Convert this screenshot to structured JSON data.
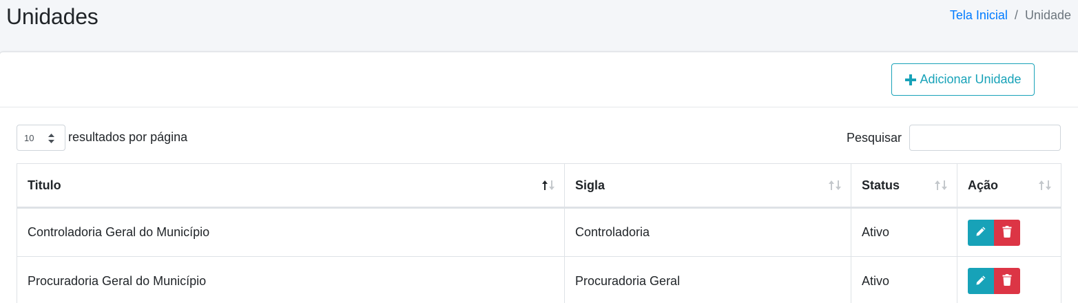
{
  "header": {
    "title": "Unidades",
    "breadcrumb": {
      "home": "Tela Inicial",
      "separator": "/",
      "current": "Unidade"
    }
  },
  "toolbar": {
    "add_label": "Adicionar Unidade",
    "add_icon": "plus-icon"
  },
  "controls": {
    "page_length": "10",
    "page_length_label": "resultados por página",
    "search_label": "Pesquisar",
    "search_value": ""
  },
  "table": {
    "columns": [
      "Titulo",
      "Sigla",
      "Status",
      "Ação"
    ],
    "sorted_column": "Titulo",
    "sort_direction": "ascending",
    "rows": [
      {
        "titulo": "Controladoria Geral do Município",
        "sigla": "Controladoria",
        "status": "Ativo"
      },
      {
        "titulo": "Procuradoria Geral do Município",
        "sigla": "Procuradoria Geral",
        "status": "Ativo"
      }
    ],
    "row_actions": {
      "edit_icon": "pencil-icon",
      "delete_icon": "trash-icon"
    }
  },
  "colors": {
    "accent": "#17a2b8",
    "danger": "#dc3545",
    "link": "#007bff",
    "background": "#f4f6f9"
  }
}
